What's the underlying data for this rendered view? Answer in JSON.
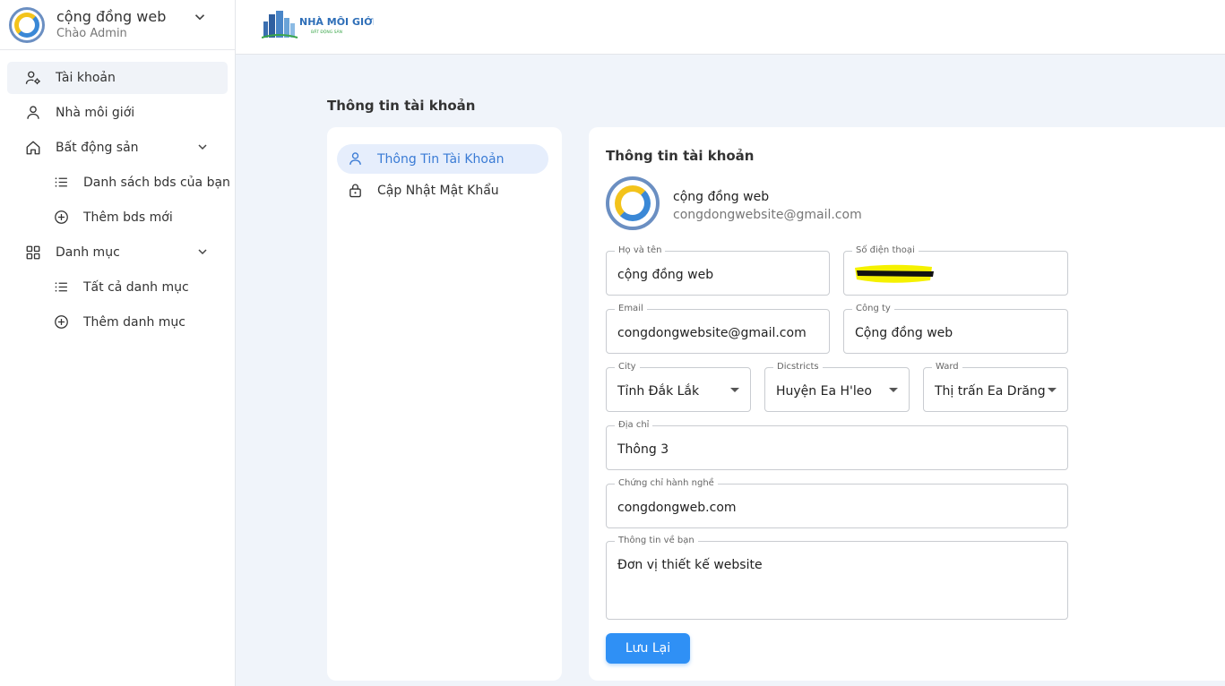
{
  "sidebar": {
    "title": "cộng đồng web",
    "subtitle": "Chào Admin",
    "items": [
      {
        "label": "Tài khoản"
      },
      {
        "label": "Nhà môi giới"
      },
      {
        "label": "Bất động sản"
      },
      {
        "label": "Danh sách bds của bạn"
      },
      {
        "label": "Thêm bds mới"
      },
      {
        "label": "Danh mục"
      },
      {
        "label": "Tất cả danh mục"
      },
      {
        "label": "Thêm danh mục"
      }
    ]
  },
  "topbar": {
    "brand_name": "NHÀ MÔI GIỚI",
    "brand_tagline": "BẤT ĐỘNG SẢN"
  },
  "page": {
    "title": "Thông tin tài khoản"
  },
  "tabs": [
    {
      "label": "Thông Tin Tài Khoản"
    },
    {
      "label": "Cập Nhật Mật Khẩu"
    }
  ],
  "profile": {
    "card_title": "Thông tin tài khoản",
    "name": "cộng đồng web",
    "email": "congdongwebsite@gmail.com"
  },
  "form": {
    "fullname": {
      "label": "Họ và tên",
      "value": "cộng đồng web"
    },
    "phone": {
      "label": "Số điện thoại",
      "value": ""
    },
    "email": {
      "label": "Email",
      "value": "congdongwebsite@gmail.com"
    },
    "company": {
      "label": "Công ty",
      "value": "Cộng đồng web"
    },
    "city": {
      "label": "City",
      "value": "Tỉnh Đắk Lắk"
    },
    "district": {
      "label": "Dicstricts",
      "value": "Huyện Ea H'leo"
    },
    "ward": {
      "label": "Ward",
      "value": "Thị trấn Ea Drăng"
    },
    "address": {
      "label": "Địa chỉ",
      "value": "Thông 3"
    },
    "license": {
      "label": "Chứng chỉ hành nghề",
      "value": "congdongweb.com"
    },
    "about": {
      "label": "Thông tin về bạn",
      "value": "Đơn vị thiết kế website"
    },
    "save_label": "Lưu Lại"
  },
  "colors": {
    "accent": "#2f90f5",
    "active_tab_text": "#3a7bd5",
    "active_tab_bg": "#e6eefc",
    "page_bg": "#f0f4fa"
  }
}
